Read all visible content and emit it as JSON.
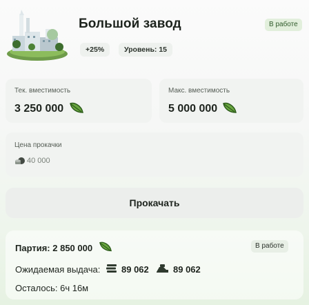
{
  "header": {
    "title": "Большой завод",
    "status": "В работе",
    "bonus": "+25%",
    "level": "Уровень: 15"
  },
  "capacity": {
    "current_label": "Тек. вместимость",
    "current_value": "3 250 000",
    "max_label": "Макс. вместимость",
    "max_value": "5 000 000"
  },
  "upgrade_cost": {
    "label": "Цена прокачки",
    "value": "40 000"
  },
  "upgrade_button": "Прокачать",
  "batch": {
    "label": "Партия:",
    "value": "2 850 000",
    "status": "В работе",
    "expected_label": "Ожидаемая выдача:",
    "expected_value_1": "89 062",
    "expected_value_2": "89 062",
    "remaining": "Осталось: 6ч 16м"
  },
  "icons": [
    "factory-image",
    "leaf-icon",
    "coins-icon",
    "cash-stack-icon",
    "money-hand-icon"
  ],
  "colors": {
    "accent": "#5d9a3a",
    "status_bg": "#e2efdc"
  }
}
